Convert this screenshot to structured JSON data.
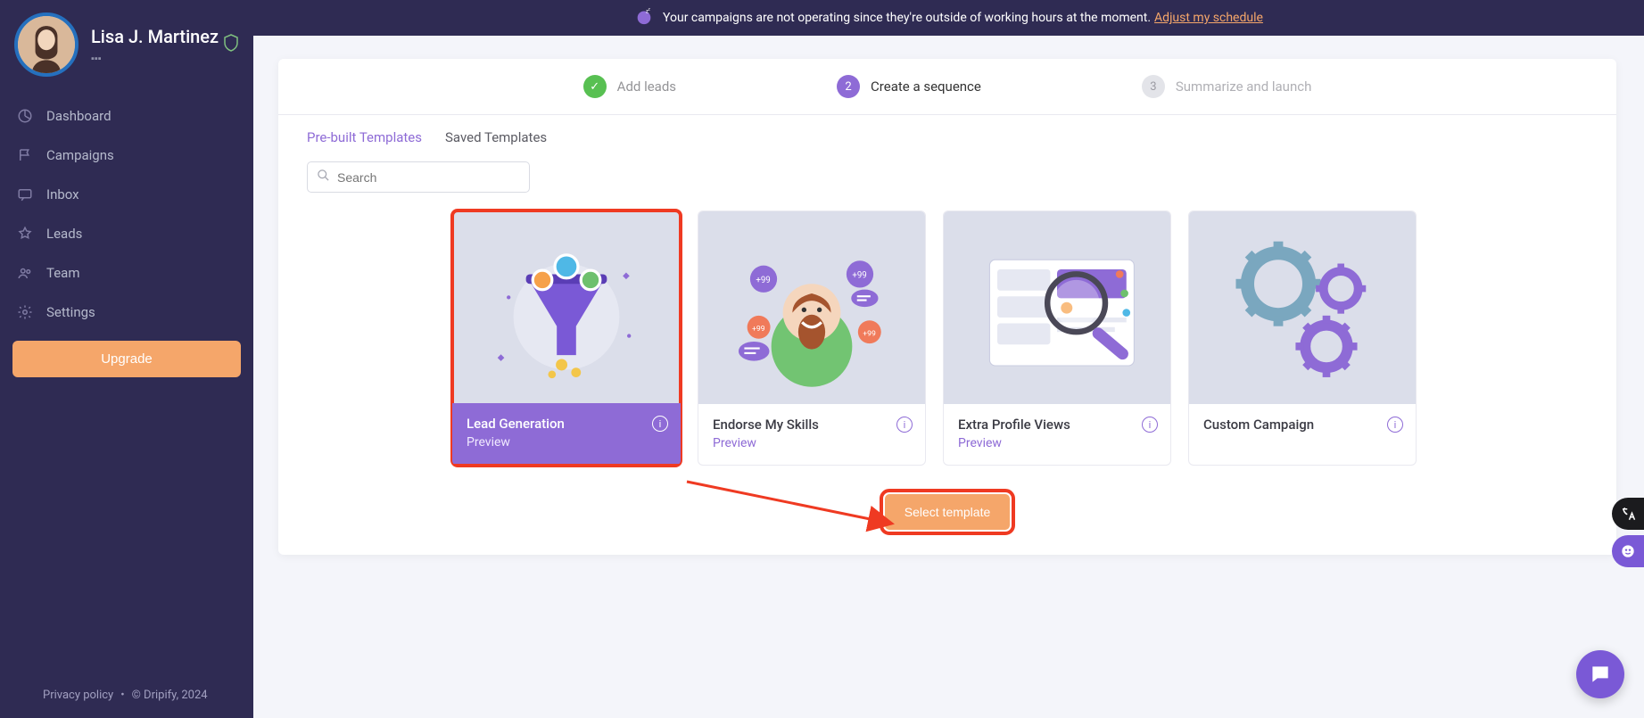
{
  "user": {
    "name": "Lisa J. Martinez"
  },
  "sidebar": {
    "items": [
      {
        "label": "Dashboard"
      },
      {
        "label": "Campaigns"
      },
      {
        "label": "Inbox"
      },
      {
        "label": "Leads"
      },
      {
        "label": "Team"
      },
      {
        "label": "Settings"
      }
    ],
    "upgrade": "Upgrade",
    "footer_privacy": "Privacy policy",
    "footer_copyright": "© Dripify, 2024"
  },
  "banner": {
    "text": "Your campaigns are not operating since they're outside of working hours at the moment.",
    "link": "Adjust my schedule"
  },
  "stepper": {
    "step1": "Add leads",
    "step2_num": "2",
    "step2": "Create a sequence",
    "step3_num": "3",
    "step3": "Summarize and launch"
  },
  "tabs": {
    "prebuilt": "Pre-built Templates",
    "saved": "Saved Templates"
  },
  "search": {
    "placeholder": "Search"
  },
  "templates": [
    {
      "title": "Lead Generation",
      "preview": "Preview"
    },
    {
      "title": "Endorse My Skills",
      "preview": "Preview"
    },
    {
      "title": "Extra Profile Views",
      "preview": "Preview"
    },
    {
      "title": "Custom Campaign"
    }
  ],
  "select_button": "Select template"
}
